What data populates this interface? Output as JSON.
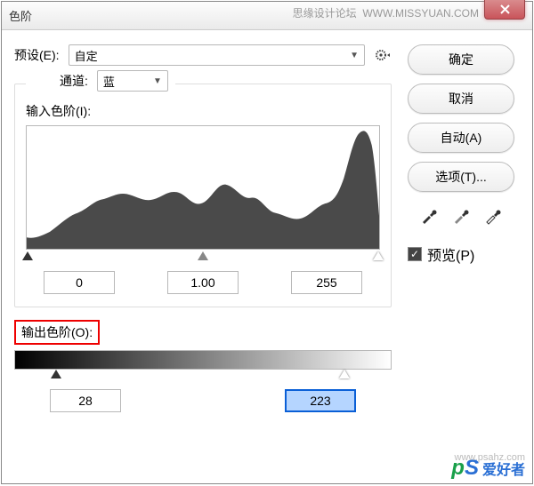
{
  "title": "色阶",
  "watermark_top": "思缘设计论坛",
  "watermark_url_top": "WWW.MISSYUAN.COM",
  "preset": {
    "label": "预设(E):",
    "value": "自定"
  },
  "channel": {
    "label": "通道:",
    "value": "蓝"
  },
  "input_label": "输入色阶(I):",
  "input_values": {
    "black": "0",
    "gamma": "1.00",
    "white": "255"
  },
  "output_label": "输出色阶(O):",
  "output_values": {
    "black": "28",
    "white": "223"
  },
  "buttons": {
    "ok": "确定",
    "cancel": "取消",
    "auto": "自动(A)",
    "options": "选项(T)..."
  },
  "preview": {
    "label": "预览(P)",
    "checked": true
  },
  "footer_logo": "爱好者",
  "footer_url": "www.psahz.com"
}
